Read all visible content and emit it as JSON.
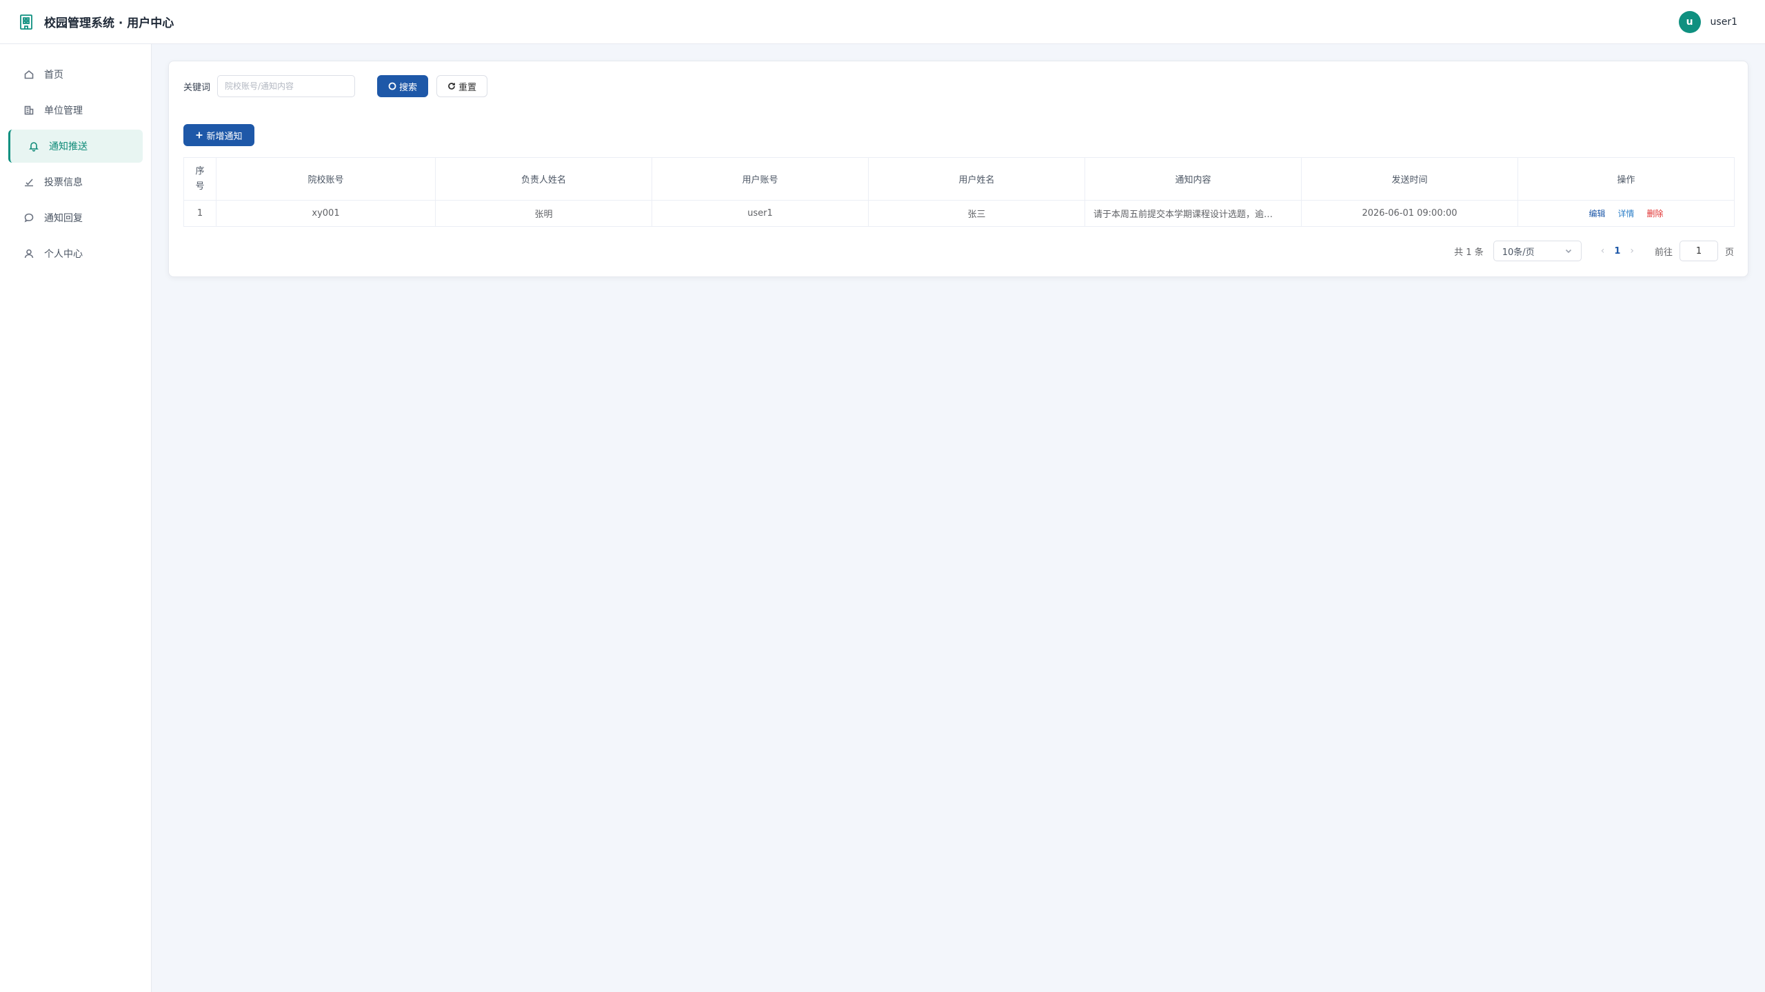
{
  "header": {
    "title": "校园管理系统 · 用户中心",
    "avatar_letter": "u",
    "username": "user1"
  },
  "sidebar": {
    "items": [
      {
        "label": "首页",
        "icon": "home-icon"
      },
      {
        "label": "单位管理",
        "icon": "building-icon"
      },
      {
        "label": "通知推送",
        "icon": "bell-icon",
        "active": true
      },
      {
        "label": "投票信息",
        "icon": "vote-icon"
      },
      {
        "label": "通知回复",
        "icon": "chat-icon"
      },
      {
        "label": "个人中心",
        "icon": "user-icon"
      }
    ]
  },
  "search": {
    "label": "关键词",
    "placeholder": "院校账号/通知内容",
    "value": "",
    "search_label": "搜索",
    "reset_label": "重置"
  },
  "toolbar": {
    "add_label": "新增通知"
  },
  "table": {
    "headers": [
      "序号",
      "院校账号",
      "负责人姓名",
      "用户账号",
      "用户姓名",
      "通知内容",
      "发送时间",
      "操作"
    ],
    "rows": [
      {
        "index": "1",
        "school_account": "xy001",
        "manager_name": "张明",
        "user_account": "user1",
        "user_name": "张三",
        "content": "请于本周五前提交本学期课程设计选题，逾…",
        "send_time": "2026-06-01 09:00:00",
        "ops": {
          "edit": "编辑",
          "detail": "详情",
          "delete": "删除"
        }
      }
    ]
  },
  "pagination": {
    "total": "共 1 条",
    "page_size": "10条/页",
    "current": "1",
    "goto_label": "前往",
    "goto_value": "1",
    "page_suffix": "页"
  },
  "colors": {
    "brand": "#0f9080",
    "primary": "#1e58a8",
    "danger": "#e03131"
  }
}
